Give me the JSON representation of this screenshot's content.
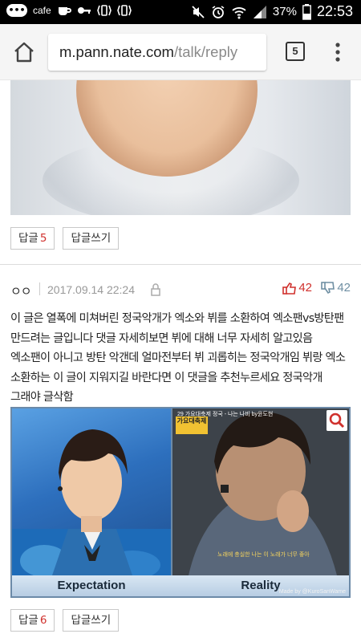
{
  "status_bar": {
    "carrier_label": "cafe",
    "battery": "37%",
    "time": "22:53"
  },
  "browser": {
    "url_host": "m.pann.nate.com",
    "url_path": "/talk/reply",
    "tab_count": "5",
    "icons": [
      "home-icon",
      "tabs-icon",
      "overflow-menu-icon"
    ]
  },
  "top_post": {
    "reply_label": "답글",
    "reply_count": "5",
    "write_reply_label": "답글쓰기"
  },
  "comment": {
    "author": "ㅇㅇ",
    "date": "2017.09.14 22:24",
    "upvotes": "42",
    "downvotes": "42",
    "text": "이 글은 열폭에 미쳐버린 정국악개가 엑소와 뷔를 소환하여 엑소팬vs방탄팬 만드려는 글입니다 댓글 자세히보면 뷔에 대해 너무 자세히 알고있음 엑소팬이 아니고 방탄 악갠데 얼마전부터 뷔 괴롭히는 정국악개임 뷔랑 엑소 소환하는 이 글이 지워지길 바란다면 이 댓글을 추천누르세요 정국악개 그래야 글삭함",
    "image": {
      "left_caption": "Expectation",
      "right_caption": "Reality",
      "watermark": "Made by @KuroSanWame",
      "broadcast_logo": "가요대축제",
      "broadcast_text": "29 가요대축제 정국 - 나는 나비 by윤도현",
      "subtitle": "노래에 충실한 나는 이 노래가 너무 좋아"
    },
    "reply_label": "답글",
    "reply_count": "6",
    "write_reply_label": "답글쓰기"
  },
  "colors": {
    "accent_red": "#d0312d",
    "downvote": "#6f8fa3",
    "status_bar_bg": "#000000"
  }
}
